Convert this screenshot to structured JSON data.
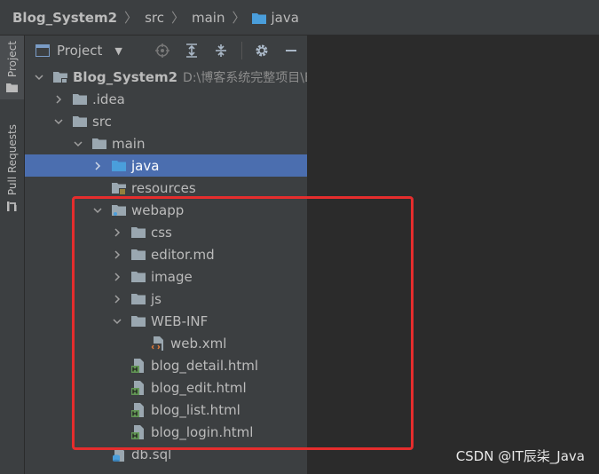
{
  "breadcrumb": {
    "project": "Blog_System2",
    "items": [
      "src",
      "main",
      "java"
    ]
  },
  "toolstrip": {
    "project_tab": "Project",
    "pull_requests_tab": "Pull Requests"
  },
  "panel": {
    "title": "Project"
  },
  "tree": {
    "root": {
      "label": "Blog_System2",
      "path": "D:\\博客系统完整项目\\B"
    },
    "idea": ".idea",
    "src": "src",
    "main": "main",
    "java": "java",
    "resources": "resources",
    "webapp": "webapp",
    "css": "css",
    "editor_md": "editor.md",
    "image": "image",
    "js": "js",
    "web_inf": "WEB-INF",
    "web_xml": "web.xml",
    "blog_detail": "blog_detail.html",
    "blog_edit": "blog_edit.html",
    "blog_list": "blog_list.html",
    "blog_login": "blog_login.html",
    "db_sql": "db.sql"
  },
  "watermark": "CSDN @IT辰柒_Java",
  "colors": {
    "selection": "#4b6eaf",
    "highlight_box": "#e52d2d",
    "folder": "#9aa7b0",
    "source_folder": "#4a9edb",
    "html_badge": "#629755"
  }
}
